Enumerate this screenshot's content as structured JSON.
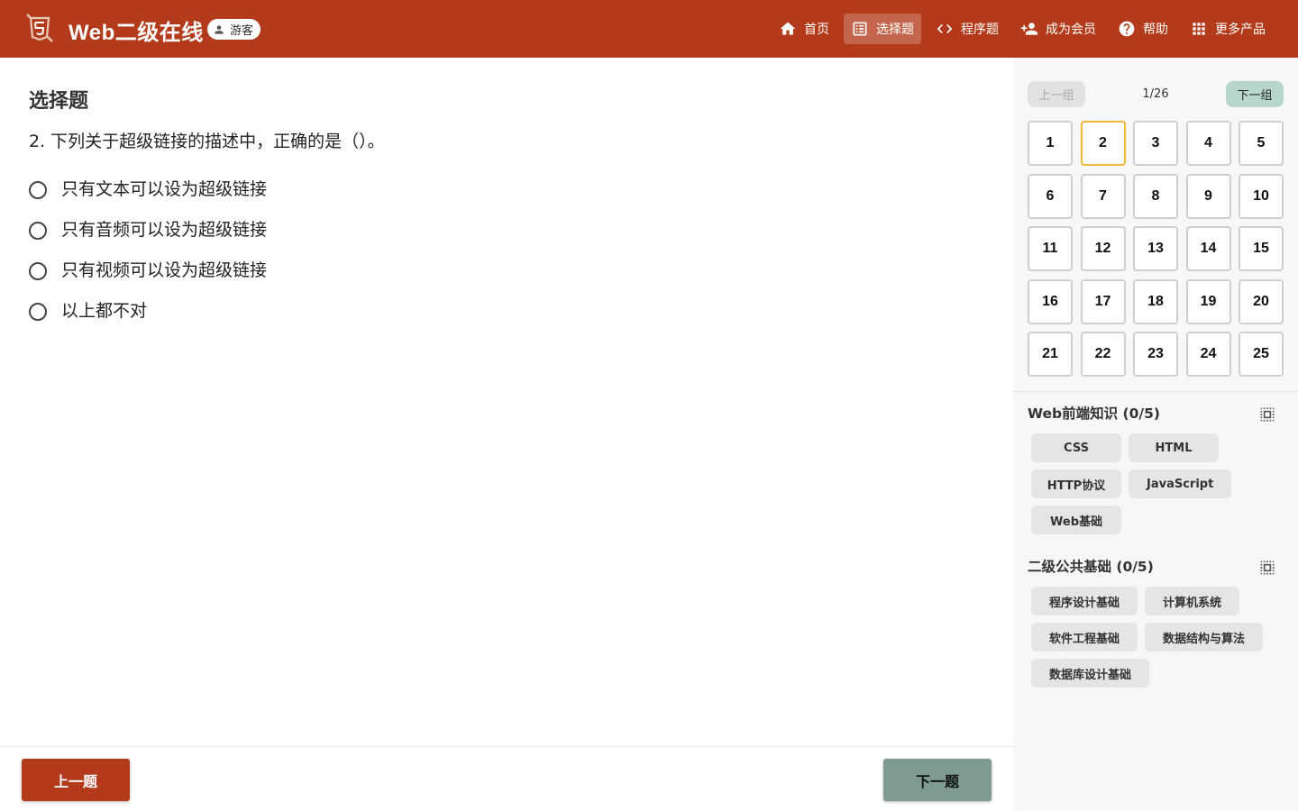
{
  "header": {
    "title": "Web二级在线",
    "user_badge": "游客",
    "nav": [
      {
        "label": "首页",
        "icon": "home-icon"
      },
      {
        "label": "选择题",
        "icon": "list-icon"
      },
      {
        "label": "程序题",
        "icon": "code-icon"
      },
      {
        "label": "成为会员",
        "icon": "person-add-icon"
      },
      {
        "label": "帮助",
        "icon": "help-icon"
      },
      {
        "label": "更多产品",
        "icon": "apps-icon"
      }
    ],
    "active_nav": "选择题",
    "colors": {
      "primary": "#b33b1b",
      "accent": "#f0b93a",
      "next_button": "#7f9a92"
    }
  },
  "main": {
    "section_title": "选择题",
    "question": "2. 下列关于超级链接的描述中，正确的是（）。",
    "options": [
      "只有文本可以设为超级链接",
      "只有音频可以设为超级链接",
      "只有视频可以设为超级链接",
      "以上都不对"
    ],
    "prev_button": "上一题",
    "next_button": "下一题"
  },
  "sidebar": {
    "group_prev": "上一组",
    "group_count": "1/26",
    "group_next": "下一组",
    "question_numbers": [
      "1",
      "2",
      "3",
      "4",
      "5",
      "6",
      "7",
      "8",
      "9",
      "10",
      "11",
      "12",
      "13",
      "14",
      "15",
      "16",
      "17",
      "18",
      "19",
      "20",
      "21",
      "22",
      "23",
      "24",
      "25"
    ],
    "current_question": "2",
    "categories": [
      {
        "title": "Web前端知识 (0/5)",
        "tags": [
          "CSS",
          "HTML",
          "HTTP协议",
          "JavaScript",
          "Web基础"
        ]
      },
      {
        "title": "二级公共基础 (0/5)",
        "tags": [
          "程序设计基础",
          "计算机系统",
          "软件工程基础",
          "数据结构与算法",
          "数据库设计基础"
        ]
      }
    ]
  }
}
